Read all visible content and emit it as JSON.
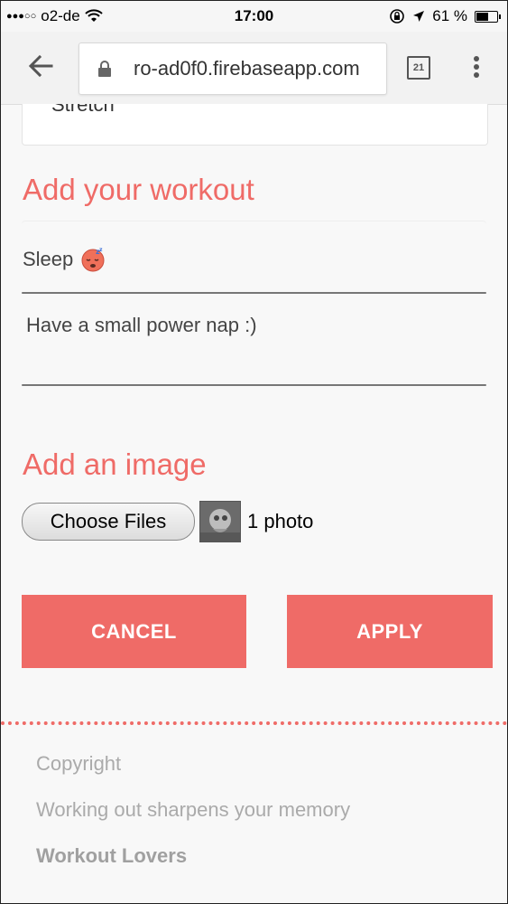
{
  "status_bar": {
    "carrier": "o2-de",
    "time": "17:00",
    "battery_percent": "61 %",
    "battery_level": 0.61
  },
  "browser": {
    "url": "ro-ad0f0.firebaseapp.com",
    "tab_count": "21"
  },
  "previous_card": {
    "partial_text": "Stretch"
  },
  "workout_form": {
    "heading": "Add your workout",
    "title_value": "Sleep",
    "title_icon": "sleeping-face-icon",
    "description_value": "Have a small power nap :)"
  },
  "image_section": {
    "heading": "Add an image",
    "choose_label": "Choose Files",
    "file_status": "1 photo"
  },
  "actions": {
    "cancel_label": "CANCEL",
    "apply_label": "APPLY"
  },
  "footer": {
    "copyright": "Copyright",
    "tagline": "Working out sharpens your memory",
    "brand": "Workout Lovers"
  },
  "colors": {
    "accent": "#ef6b67",
    "footer_text": "#aaaaaa"
  }
}
